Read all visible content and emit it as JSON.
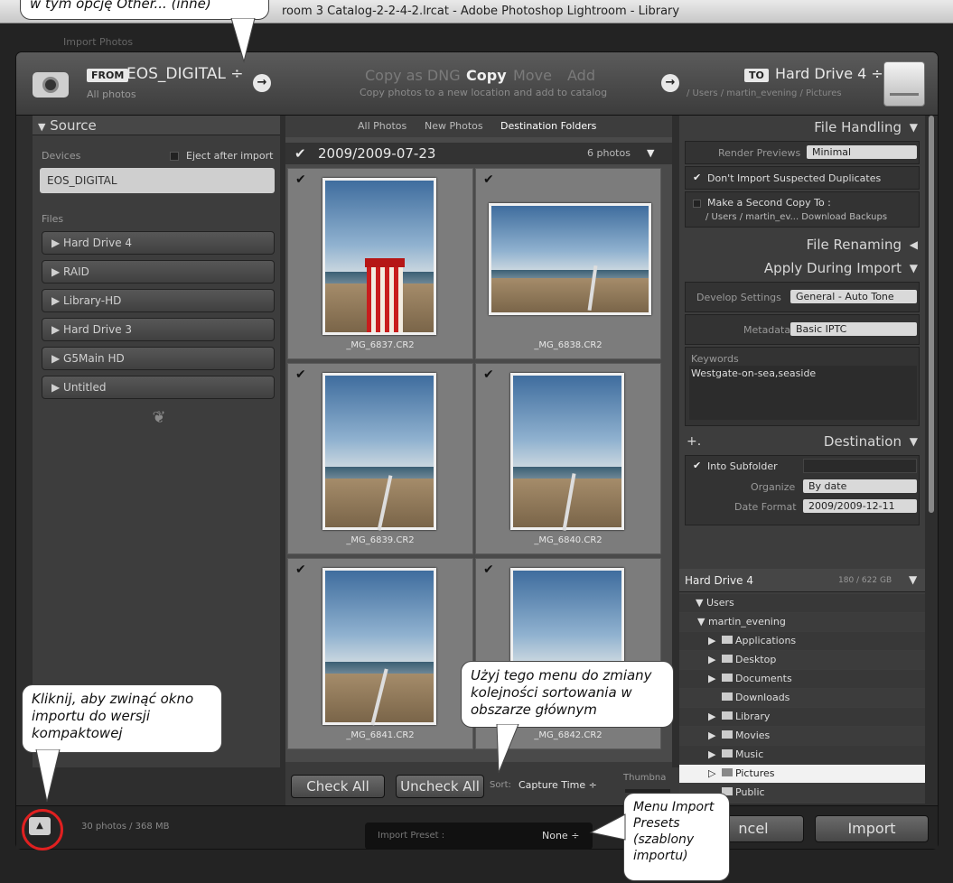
{
  "window": {
    "title": "room 3 Catalog-2-2-4-2.lrcat - Adobe Photoshop Lightroom - Library"
  },
  "background": {
    "import_photos": "Import Photos"
  },
  "from": {
    "badge": "FROM",
    "device": "EOS_DIGITAL ÷",
    "sub": "All photos"
  },
  "modes": {
    "copy_dng": "Copy as DNG",
    "copy": "Copy",
    "move": "Move",
    "add": "Add",
    "description": "Copy photos to a new location and add to catalog"
  },
  "to": {
    "badge": "TO",
    "drive": "Hard Drive 4 ÷",
    "path": "/ Users / martin_evening / Pictures"
  },
  "source": {
    "title": "Source",
    "devices_label": "Devices",
    "eject_label": "Eject after import",
    "device_selected": "EOS_DIGITAL",
    "files_label": "Files",
    "volumes": [
      "Hard Drive 4",
      "RAID",
      "Library-HD",
      "Hard Drive 3",
      "G5Main HD",
      "Untitled"
    ]
  },
  "grid": {
    "tabs": [
      "All Photos",
      "New Photos",
      "Destination Folders"
    ],
    "folder": "2009/2009-07-23",
    "count": "6 photos",
    "photos": [
      "_MG_6837.CR2",
      "_MG_6838.CR2",
      "_MG_6839.CR2",
      "_MG_6840.CR2",
      "_MG_6841.CR2",
      "_MG_6842.CR2"
    ],
    "check_all": "Check All",
    "uncheck_all": "Uncheck All",
    "sort_label": "Sort:",
    "sort_value": "Capture Time ÷",
    "thumbnail_label": "Thumbna"
  },
  "file_handling": {
    "title": "File Handling",
    "render_label": "Render Previews",
    "render_value": "Minimal",
    "no_duplicates": "Don't Import Suspected Duplicates",
    "second_copy": "Make a Second Copy To :",
    "second_copy_path": "/ Users / martin_ev... Download Backups"
  },
  "file_renaming": {
    "title": "File Renaming"
  },
  "apply": {
    "title": "Apply During Import",
    "develop_label": "Develop Settings",
    "develop_value": "General - Auto Tone",
    "metadata_label": "Metadata",
    "metadata_value": "Basic IPTC",
    "keywords_label": "Keywords",
    "keywords_value": "Westgate-on-sea,seaside"
  },
  "destination": {
    "title": "Destination",
    "into_subfolder": "Into Subfolder",
    "organize_label": "Organize",
    "organize_value": "By date",
    "date_format_label": "Date Format",
    "date_format_value": "2009/2009-12-11",
    "drive": "Hard Drive 4",
    "drive_size": "180 / 622 GB",
    "tree": [
      "Users",
      "martin_evening",
      "Applications",
      "Desktop",
      "Documents",
      "Downloads",
      "Library",
      "Movies",
      "Music",
      "Pictures",
      "Public"
    ]
  },
  "footer": {
    "summary": "30 photos / 368 MB",
    "preset_label": "Import Preset :",
    "preset_value": "None ÷",
    "cancel": "ncel",
    "import": "Import"
  },
  "callouts": {
    "top": "w tym opcję Other... (inne)",
    "sort": "Użyj tego menu do zmiany kolejności sortowania w obszarze głównym",
    "collapse": "Kliknij, aby zwinąć okno importu do wersji kompaktowej",
    "presets": "Menu Import Presets (szablony importu)"
  }
}
